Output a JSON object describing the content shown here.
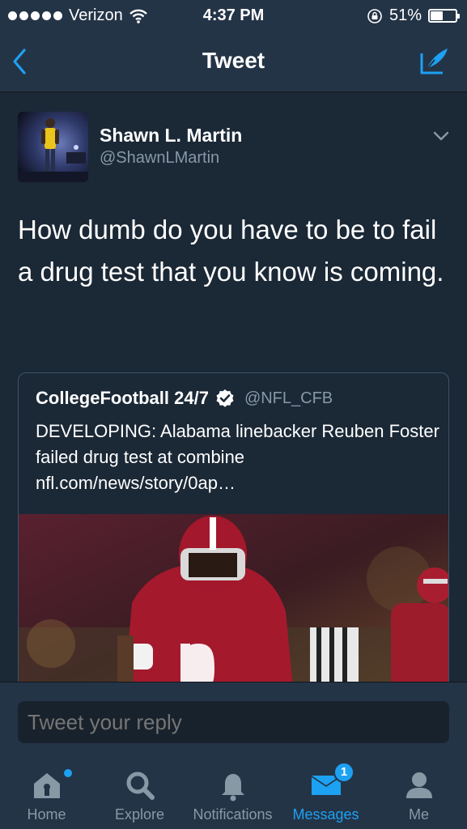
{
  "status_bar": {
    "carrier": "Verizon",
    "time": "4:37 PM",
    "battery": "51%",
    "battery_level": 0.51
  },
  "nav": {
    "title": "Tweet",
    "back_icon": "chevron-left-icon",
    "compose_icon": "compose-quill-icon"
  },
  "tweet": {
    "author_name": "Shawn L. Martin",
    "author_handle": "@ShawnLMartin",
    "text": "How dumb do you have to be to fail a drug test that you know is coming."
  },
  "quote": {
    "name": "CollegeFootball 24/7",
    "handle": "@NFL_CFB",
    "verified": true,
    "text": "DEVELOPING: Alabama linebacker Reuben Foster failed drug test at combine nfl.com/news/story/0ap…"
  },
  "reply": {
    "placeholder": "Tweet your reply"
  },
  "tabs": [
    {
      "label": "Home",
      "icon": "home-icon",
      "notification_dot": true
    },
    {
      "label": "Explore",
      "icon": "search-icon"
    },
    {
      "label": "Notifications",
      "icon": "bell-icon"
    },
    {
      "label": "Messages",
      "icon": "envelope-icon",
      "active": true,
      "badge": "1"
    },
    {
      "label": "Me",
      "icon": "person-icon"
    }
  ],
  "colors": {
    "background": "#1b2836",
    "bar": "#243447",
    "accent": "#1da1f2",
    "secondary_text": "#8899a6"
  }
}
